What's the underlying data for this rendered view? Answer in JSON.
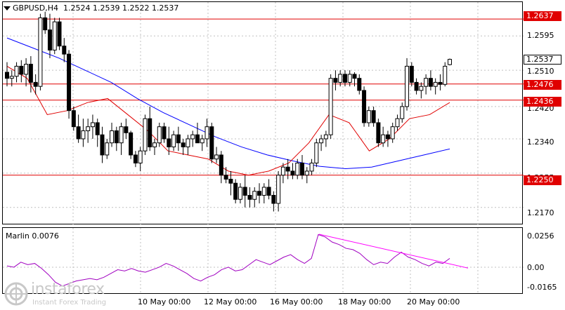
{
  "header": {
    "symbol": "GBPUSD,H4",
    "ohlc": "1.2524 1.2539 1.2522 1.2537"
  },
  "indicator": {
    "label": "Marlin 0.0076",
    "axis_labels": [
      "0.0256",
      "0.00",
      "-0.0165"
    ]
  },
  "price_axis": {
    "labels": [
      "1.2595",
      "1.2510",
      "1.2420",
      "1.2340",
      "1.2255",
      "1.2170"
    ]
  },
  "levels": [
    "1.2637",
    "1.2476",
    "1.2436",
    "1.2250"
  ],
  "current_price": "1.2537",
  "time_axis": [
    "10 May 00:00",
    "12 May 00:00",
    "16 May 00:00",
    "18 May 00:00",
    "20 May 00:00"
  ],
  "watermark": {
    "name": "instaforex",
    "tagline": "Instant Forex Trading"
  },
  "colors": {
    "level": "#e00000",
    "envelope": "#e00000",
    "ma": "#0000ff",
    "oscillator": "#a000c0",
    "trendline": "#ff00ff"
  },
  "chart_data": {
    "type": "candlestick",
    "price_range": [
      1.214,
      1.2665
    ],
    "oscillator_range": [
      -0.019,
      0.029
    ],
    "candles": [
      [
        1.2505,
        1.253,
        1.247,
        1.249
      ],
      [
        1.249,
        1.251,
        1.247,
        1.2495
      ],
      [
        1.2495,
        1.253,
        1.248,
        1.252
      ],
      [
        1.252,
        1.2535,
        1.248,
        1.25
      ],
      [
        1.25,
        1.254,
        1.247,
        1.2525
      ],
      [
        1.2525,
        1.2545,
        1.2455,
        1.248
      ],
      [
        1.248,
        1.25,
        1.245,
        1.247
      ],
      [
        1.247,
        1.265,
        1.246,
        1.264
      ],
      [
        1.264,
        1.2655,
        1.26,
        1.261
      ],
      [
        1.261,
        1.265,
        1.254,
        1.256
      ],
      [
        1.256,
        1.264,
        1.255,
        1.263
      ],
      [
        1.263,
        1.264,
        1.256,
        1.257
      ],
      [
        1.257,
        1.259,
        1.253,
        1.255
      ],
      [
        1.255,
        1.256,
        1.239,
        1.241
      ],
      [
        1.241,
        1.242,
        1.236,
        1.237
      ],
      [
        1.237,
        1.24,
        1.233,
        1.234
      ],
      [
        1.234,
        1.239,
        1.232,
        1.236
      ],
      [
        1.236,
        1.239,
        1.233,
        1.237
      ],
      [
        1.237,
        1.24,
        1.234,
        1.238
      ],
      [
        1.238,
        1.239,
        1.232,
        1.235
      ],
      [
        1.235,
        1.237,
        1.228,
        1.23
      ],
      [
        1.23,
        1.234,
        1.229,
        1.233
      ],
      [
        1.233,
        1.238,
        1.232,
        1.236
      ],
      [
        1.236,
        1.237,
        1.231,
        1.233
      ],
      [
        1.233,
        1.238,
        1.23,
        1.237
      ],
      [
        1.237,
        1.239,
        1.234,
        1.2355
      ],
      [
        1.2355,
        1.236,
        1.229,
        1.23
      ],
      [
        1.23,
        1.231,
        1.227,
        1.228
      ],
      [
        1.228,
        1.232,
        1.226,
        1.231
      ],
      [
        1.231,
        1.24,
        1.23,
        1.239
      ],
      [
        1.239,
        1.242,
        1.231,
        1.232
      ],
      [
        1.232,
        1.234,
        1.23,
        1.233
      ],
      [
        1.233,
        1.238,
        1.232,
        1.237
      ],
      [
        1.237,
        1.238,
        1.233,
        1.234
      ],
      [
        1.234,
        1.237,
        1.23,
        1.232
      ],
      [
        1.232,
        1.236,
        1.231,
        1.235
      ],
      [
        1.235,
        1.237,
        1.231,
        1.233
      ],
      [
        1.233,
        1.234,
        1.23,
        1.232
      ],
      [
        1.232,
        1.235,
        1.23,
        1.234
      ],
      [
        1.234,
        1.236,
        1.232,
        1.235
      ],
      [
        1.235,
        1.238,
        1.233,
        1.233
      ],
      [
        1.233,
        1.235,
        1.231,
        1.234
      ],
      [
        1.234,
        1.239,
        1.232,
        1.237
      ],
      [
        1.237,
        1.238,
        1.228,
        1.229
      ],
      [
        1.229,
        1.232,
        1.228,
        1.23
      ],
      [
        1.23,
        1.231,
        1.223,
        1.225
      ],
      [
        1.225,
        1.227,
        1.223,
        1.224
      ],
      [
        1.224,
        1.226,
        1.22,
        1.223
      ],
      [
        1.223,
        1.224,
        1.218,
        1.219
      ],
      [
        1.219,
        1.223,
        1.218,
        1.222
      ],
      [
        1.222,
        1.225,
        1.217,
        1.22
      ],
      [
        1.22,
        1.222,
        1.217,
        1.219
      ],
      [
        1.219,
        1.222,
        1.217,
        1.221
      ],
      [
        1.221,
        1.223,
        1.218,
        1.22
      ],
      [
        1.22,
        1.223,
        1.218,
        1.222
      ],
      [
        1.222,
        1.224,
        1.219,
        1.22
      ],
      [
        1.22,
        1.221,
        1.216,
        1.218
      ],
      [
        1.218,
        1.226,
        1.216,
        1.225
      ],
      [
        1.225,
        1.228,
        1.223,
        1.227
      ],
      [
        1.227,
        1.229,
        1.224,
        1.226
      ],
      [
        1.226,
        1.228,
        1.224,
        1.225
      ],
      [
        1.225,
        1.229,
        1.224,
        1.228
      ],
      [
        1.228,
        1.23,
        1.224,
        1.225
      ],
      [
        1.225,
        1.227,
        1.223,
        1.226
      ],
      [
        1.226,
        1.229,
        1.225,
        1.228
      ],
      [
        1.228,
        1.234,
        1.227,
        1.233
      ],
      [
        1.233,
        1.235,
        1.231,
        1.234
      ],
      [
        1.234,
        1.236,
        1.232,
        1.235
      ],
      [
        1.235,
        1.25,
        1.234,
        1.249
      ],
      [
        1.249,
        1.251,
        1.246,
        1.248
      ],
      [
        1.248,
        1.251,
        1.247,
        1.25
      ],
      [
        1.25,
        1.251,
        1.247,
        1.248
      ],
      [
        1.248,
        1.251,
        1.247,
        1.25
      ],
      [
        1.25,
        1.2505,
        1.247,
        1.249
      ],
      [
        1.249,
        1.25,
        1.245,
        1.246
      ],
      [
        1.246,
        1.247,
        1.237,
        1.238
      ],
      [
        1.238,
        1.242,
        1.237,
        1.241
      ],
      [
        1.241,
        1.242,
        1.237,
        1.238
      ],
      [
        1.238,
        1.239,
        1.232,
        1.233
      ],
      [
        1.233,
        1.237,
        1.232,
        1.235
      ],
      [
        1.235,
        1.236,
        1.232,
        1.234
      ],
      [
        1.234,
        1.238,
        1.233,
        1.237
      ],
      [
        1.237,
        1.24,
        1.236,
        1.239
      ],
      [
        1.239,
        1.243,
        1.238,
        1.242
      ],
      [
        1.242,
        1.254,
        1.241,
        1.252
      ],
      [
        1.252,
        1.253,
        1.247,
        1.248
      ],
      [
        1.248,
        1.249,
        1.245,
        1.246
      ],
      [
        1.246,
        1.248,
        1.244,
        1.247
      ],
      [
        1.247,
        1.25,
        1.245,
        1.249
      ],
      [
        1.249,
        1.251,
        1.246,
        1.247
      ],
      [
        1.247,
        1.249,
        1.245,
        1.248
      ],
      [
        1.248,
        1.25,
        1.246,
        1.2475
      ],
      [
        1.2475,
        1.253,
        1.247,
        1.252
      ],
      [
        1.2524,
        1.2539,
        1.2522,
        1.2537
      ]
    ],
    "moving_average": [
      1.259,
      1.2565,
      1.254,
      1.251,
      1.248,
      1.244,
      1.2405,
      1.2375,
      1.2345,
      1.232,
      1.23,
      1.2285,
      1.2272,
      1.2266,
      1.227,
      1.2285,
      1.23,
      1.2315
    ],
    "envelope": [
      1.252,
      1.249,
      1.24,
      1.241,
      1.243,
      1.244,
      1.24,
      1.236,
      1.231,
      1.23,
      1.229,
      1.226,
      1.225,
      1.226,
      1.228,
      1.233,
      1.24,
      1.238,
      1.231,
      1.234,
      1.239,
      1.24,
      1.243
    ],
    "oscillator": [
      0.001,
      0.0,
      0.004,
      0.002,
      0.003,
      -0.001,
      -0.006,
      -0.012,
      -0.015,
      -0.013,
      -0.011,
      -0.01,
      -0.009,
      -0.01,
      -0.008,
      -0.005,
      -0.002,
      -0.003,
      -0.001,
      -0.003,
      -0.004,
      -0.002,
      0.0,
      0.003,
      0.001,
      -0.002,
      -0.005,
      -0.009,
      -0.011,
      -0.008,
      -0.006,
      -0.002,
      0.0,
      -0.003,
      -0.002,
      0.002,
      0.006,
      0.004,
      0.002,
      0.005,
      0.008,
      0.01,
      0.006,
      0.003,
      0.007,
      0.026,
      0.024,
      0.02,
      0.018,
      0.015,
      0.014,
      0.011,
      0.006,
      0.002,
      0.004,
      0.003,
      0.008,
      0.012,
      0.008,
      0.006,
      0.003,
      0.001,
      0.004,
      0.003,
      0.007
    ]
  }
}
